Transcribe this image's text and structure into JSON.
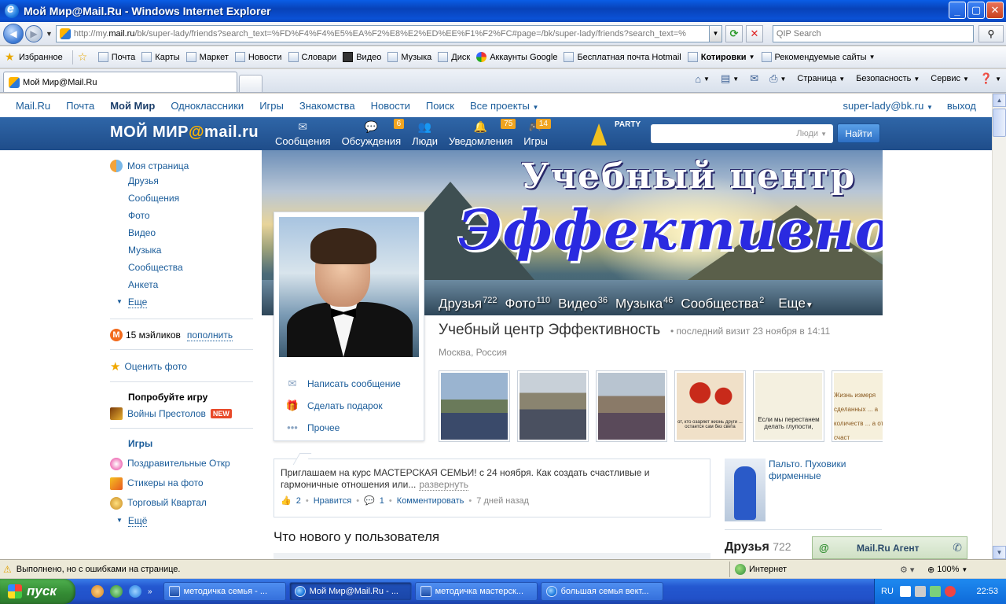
{
  "window": {
    "title": "Мой Мир@Mail.Ru - Windows Internet Explorer"
  },
  "address": {
    "url_prefix": "http://my.",
    "url_host": "mail.ru",
    "url_rest": "/bk/super-lady/friends?search_text=%FD%F4%F4%E5%EA%F2%E8%E2%ED%EE%F1%F2%FC#page=/bk/super-lady/friends?search_text=%",
    "search_placeholder": "QIP Search"
  },
  "favorites": {
    "label": "Избранное",
    "items": [
      "Почта",
      "Карты",
      "Маркет",
      "Новости",
      "Словари",
      "Видео",
      "Музыка",
      "Диск",
      "Аккаунты Google",
      "Бесплатная почта Hotmail",
      "Котировки",
      "Рекомендуемые сайты"
    ]
  },
  "tab": {
    "label": "Мой Мир@Mail.Ru"
  },
  "commands": {
    "page": "Страница",
    "safety": "Безопасность",
    "service": "Сервис"
  },
  "portal": {
    "links": [
      "Mail.Ru",
      "Почта",
      "Мой Мир",
      "Одноклассники",
      "Игры",
      "Знакомства",
      "Новости",
      "Поиск",
      "Все проекты"
    ],
    "user": "super-lady@bk.ru",
    "logout": "выход"
  },
  "header": {
    "logo_a": "МОЙ МИР",
    "logo_at": "@",
    "logo_b": "mail.ru",
    "nav": [
      {
        "label": "Сообщения",
        "badge": ""
      },
      {
        "label": "Обсуждения",
        "badge": "6"
      },
      {
        "label": "Люди",
        "badge": ""
      },
      {
        "label": "Уведомления",
        "badge": "75"
      },
      {
        "label": "Игры",
        "badge": "14"
      }
    ],
    "party": "PARTY",
    "search_scope": "Люди",
    "find_label": "Найти"
  },
  "sidebar": {
    "my_page": "Моя страница",
    "items": [
      "Друзья",
      "Сообщения",
      "Фото",
      "Видео",
      "Музыка",
      "Сообщества",
      "Анкета"
    ],
    "more": "Еще",
    "mailiki": "15 мэйликов",
    "refill": "пополнить",
    "rate_photo": "Оценить фото",
    "try_game": "Попробуйте игру",
    "game_name": "Войны Престолов",
    "new_badge": "NEW",
    "games_title": "Игры",
    "games": [
      "Поздравительные Откр",
      "Стикеры на фото",
      "Торговый Квартал"
    ],
    "games_more": "Ещё"
  },
  "cover": {
    "title_line1": "Учебный центр",
    "title_line2": "Эффективность",
    "stats": [
      {
        "label": "Друзья",
        "count": "722"
      },
      {
        "label": "Фото",
        "count": "110"
      },
      {
        "label": "Видео",
        "count": "36"
      },
      {
        "label": "Музыка",
        "count": "46"
      },
      {
        "label": "Сообщества",
        "count": "2"
      }
    ],
    "more": "Еще"
  },
  "profile": {
    "name": "Учебный центр Эффективность",
    "last_visit": "последний визит 23 ноября в 14:11",
    "location": "Москва, Россия",
    "actions": [
      "Написать сообщение",
      "Сделать подарок",
      "Прочее"
    ],
    "photo_captions": [
      "",
      "",
      "",
      "от, кто озаряет жизнь други ... остается сам без света",
      "Если мы перестанем делать глупости,",
      "Жизнь измеря сделанных ... а количеств ... а от счаст"
    ]
  },
  "post": {
    "text": "Приглашаем на курс МАСТЕРСКАЯ СЕМЬИ! с 24 ноября. Как создать счастливые и гармоничные отношения или...",
    "expand": "развернуть",
    "likes": "2",
    "like_label": "Нравится",
    "comments": "1",
    "comment_label": "Комментировать",
    "ago": "7 дней назад"
  },
  "whatsnew": "Что нового у пользователя",
  "ad": {
    "text": "Пальто. Пуховики фирменные"
  },
  "friends_block": {
    "title": "Друзья",
    "count": "722"
  },
  "agent": {
    "label": "Mail.Ru Агент"
  },
  "status": {
    "text": "Выполнено, но с ошибками на странице.",
    "zone": "Интернет",
    "zoom": "100%"
  },
  "taskbar": {
    "start": "пуск",
    "tasks": [
      "методичка семья - ...",
      "Мой Мир@Mail.Ru - ...",
      "методичка мастерск...",
      "большая семья вект..."
    ],
    "lang": "RU",
    "clock": "22:53"
  },
  "colors": {
    "link": "#1a5c9a",
    "header_blue": "#2f66a8",
    "badge": "#f0a420",
    "xp_blue": "#2458d0"
  }
}
